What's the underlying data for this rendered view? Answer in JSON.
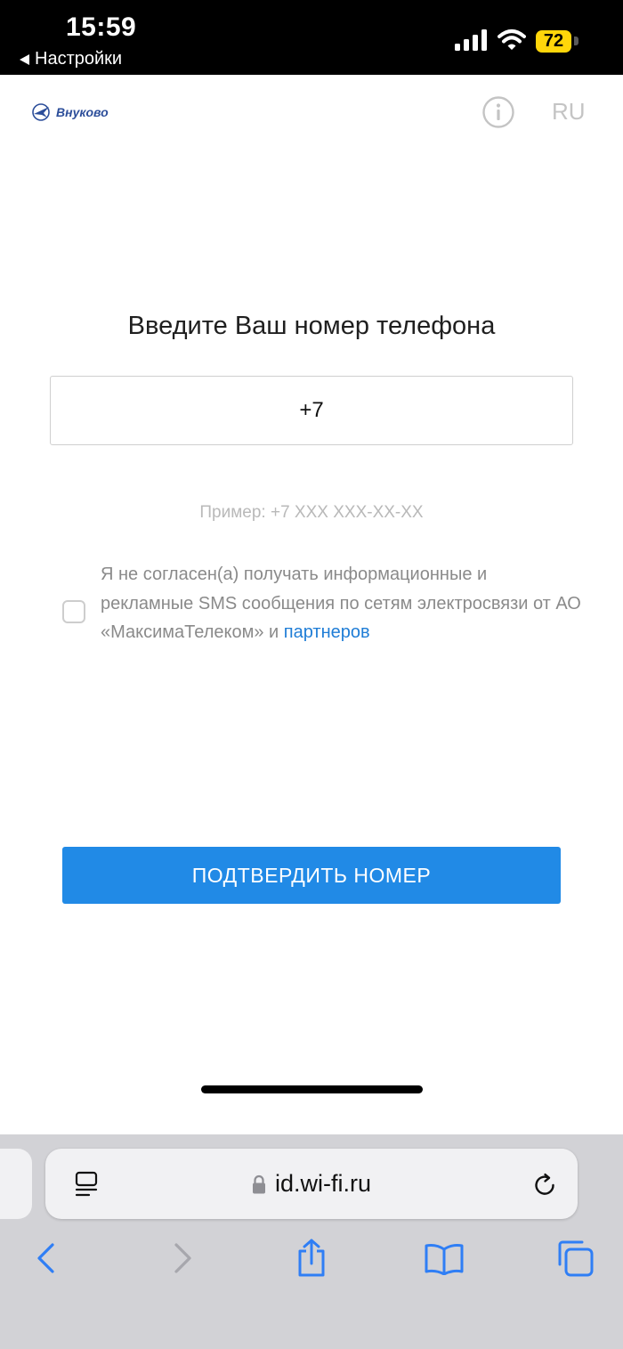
{
  "status_bar": {
    "time": "15:59",
    "back_label": "Настройки",
    "battery_level": "72",
    "battery_color": "#ffd60a"
  },
  "header": {
    "logo_text": "Внуково",
    "language": "RU",
    "info_icon": "info-circle-icon"
  },
  "form": {
    "title": "Введите Ваш номер телефона",
    "phone_value": "+7",
    "phone_hint": "Пример: +7 XXX XXX-XX-XX",
    "consent_checked": false,
    "consent_text": "Я не согласен(а) получать информационные и рекламные SMS сообщения по сетям электросвязи от АО «МаксимаТелеком» и",
    "consent_link": "партнеров",
    "submit_label": "ПОДТВЕРДИТЬ НОМЕР",
    "accent_color": "#218ae6"
  },
  "browser": {
    "url": "id.wi-fi.ru",
    "toolbar_icons": [
      "back-icon",
      "forward-icon",
      "share-icon",
      "bookmarks-icon",
      "tabs-icon"
    ]
  }
}
